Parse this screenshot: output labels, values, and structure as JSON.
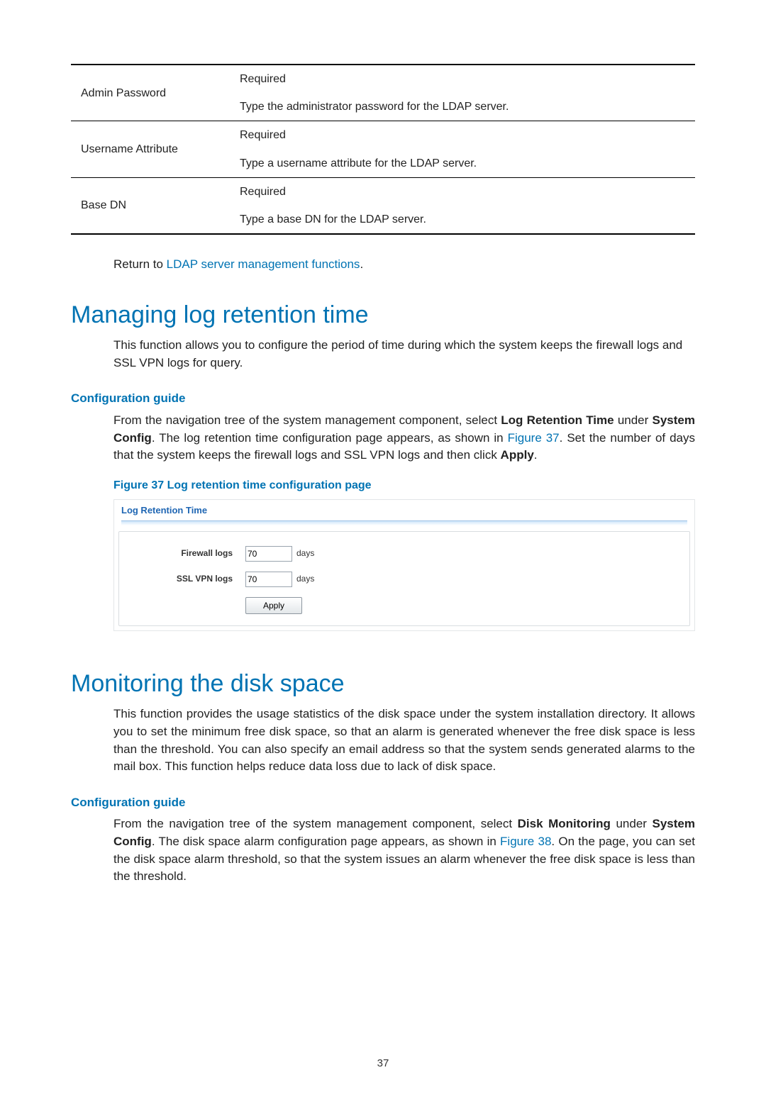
{
  "ldap_table": {
    "rows": [
      {
        "key": "Admin Password",
        "required": "Required",
        "desc": "Type the administrator password for the LDAP server."
      },
      {
        "key": "Username Attribute",
        "required": "Required",
        "desc": "Type a username attribute for the LDAP server."
      },
      {
        "key": "Base DN",
        "required": "Required",
        "desc": "Type a base DN for the LDAP server."
      }
    ]
  },
  "return_line": {
    "prefix": "Return to ",
    "link_text": "LDAP server management functions",
    "suffix": "."
  },
  "sections": {
    "log_retention": {
      "title": "Managing log retention time",
      "intro": "This function allows you to configure the period of time during which the system keeps the firewall logs and SSL VPN logs for query.",
      "guide_heading": "Configuration guide",
      "guide_para": {
        "p1a": "From the navigation tree of the system management component, select ",
        "b1": "Log Retention Time",
        "p1b": " under ",
        "b2": "System Config",
        "p1c": ". The log retention time configuration page appears, as shown in ",
        "link": "Figure 37",
        "p1d": ". Set the number of days that the system keeps the firewall logs and SSL VPN logs and then click ",
        "b3": "Apply",
        "p1e": "."
      },
      "figure_caption": "Figure 37 Log retention time configuration page",
      "screenshot": {
        "header": "Log Retention Time",
        "firewall_label": "Firewall logs",
        "firewall_value": "70",
        "ssl_label": "SSL VPN logs",
        "ssl_value": "70",
        "unit": "days",
        "apply_label": "Apply"
      }
    },
    "disk_space": {
      "title": "Monitoring the disk space",
      "intro": "This function provides the usage statistics of the disk space under the system installation directory. It allows you to set the minimum free disk space, so that an alarm is generated whenever the free disk space is less than the threshold. You can also specify an email address so that the system sends generated alarms to the mail box. This function helps reduce data loss due to lack of disk space.",
      "guide_heading": "Configuration guide",
      "guide_para": {
        "p1a": "From the navigation tree of the system management component, select ",
        "b1": "Disk Monitoring",
        "p1b": " under ",
        "b2": "System Config",
        "p1c": ". The disk space alarm configuration page appears, as shown in ",
        "link": "Figure 38",
        "p1d": ". On the page, you can set the disk space alarm threshold, so that the system issues an alarm whenever the free disk space is less than the threshold."
      }
    }
  },
  "page_number": "37"
}
